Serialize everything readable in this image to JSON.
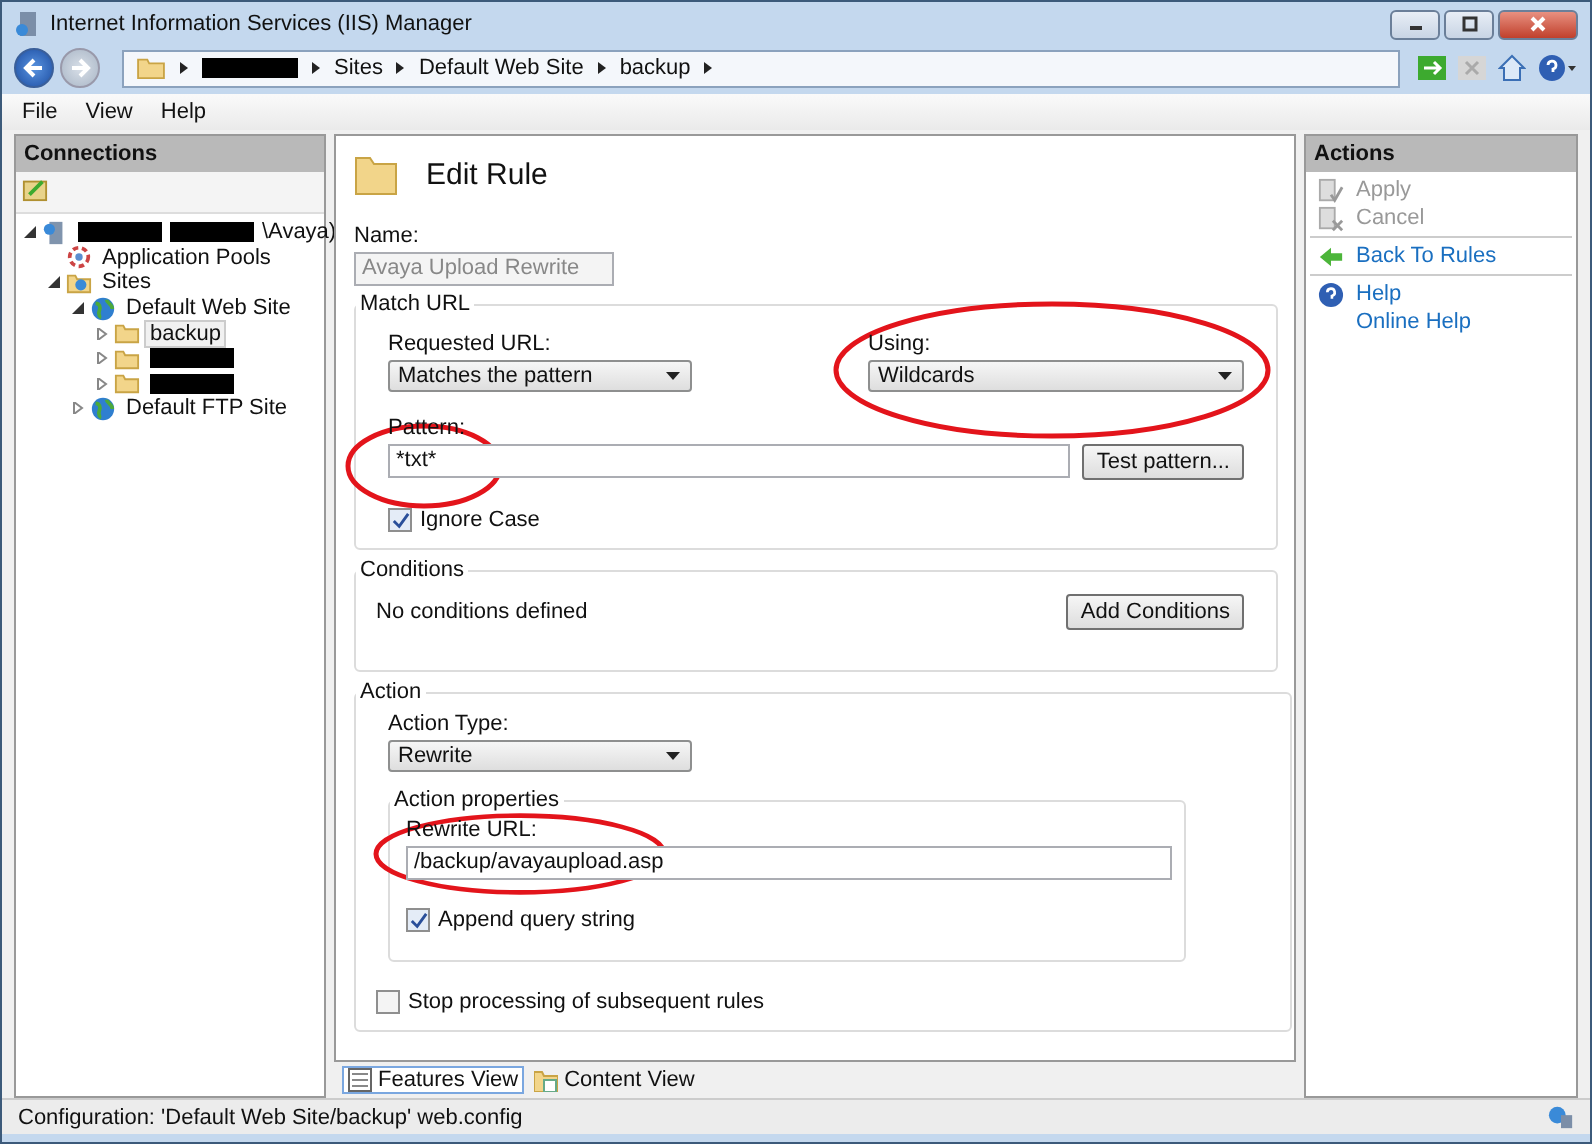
{
  "window": {
    "title": "Internet Information Services (IIS) Manager"
  },
  "address_bar": {
    "crumbs": [
      {
        "kind": "redacted"
      },
      {
        "kind": "text",
        "text": "Sites"
      },
      {
        "kind": "text",
        "text": "Default Web Site"
      },
      {
        "kind": "text",
        "text": "backup"
      }
    ]
  },
  "menu": [
    "File",
    "View",
    "Help"
  ],
  "connections": {
    "title": "Connections",
    "tree": [
      {
        "kind": "server",
        "expanded": true,
        "selected": false,
        "parts": [
          {
            "kind": "redacted"
          },
          {
            "kind": "redacted"
          },
          {
            "kind": "text",
            "text": "\\Avaya)"
          }
        ],
        "children": [
          {
            "kind": "pool",
            "selected": false,
            "parts": [
              {
                "kind": "text",
                "text": "Application Pools"
              }
            ]
          },
          {
            "kind": "sites",
            "expanded": true,
            "selected": false,
            "parts": [
              {
                "kind": "text",
                "text": "Sites"
              }
            ],
            "children": [
              {
                "kind": "globe",
                "expanded": true,
                "selected": false,
                "parts": [
                  {
                    "kind": "text",
                    "text": "Default Web Site"
                  }
                ],
                "children": [
                  {
                    "kind": "folder",
                    "expanded": false,
                    "selected": true,
                    "parts": [
                      {
                        "kind": "text",
                        "text": "backup"
                      }
                    ]
                  },
                  {
                    "kind": "folder",
                    "expanded": false,
                    "selected": false,
                    "parts": [
                      {
                        "kind": "redacted"
                      }
                    ]
                  },
                  {
                    "kind": "folder",
                    "expanded": false,
                    "selected": false,
                    "parts": [
                      {
                        "kind": "redacted"
                      }
                    ]
                  }
                ]
              },
              {
                "kind": "globe",
                "expanded": false,
                "selected": false,
                "parts": [
                  {
                    "kind": "text",
                    "text": "Default FTP Site"
                  }
                ]
              }
            ]
          }
        ]
      }
    ]
  },
  "editor": {
    "title": "Edit Rule",
    "name_label": "Name:",
    "name_value": "Avaya Upload Rewrite",
    "match_url": {
      "legend": "Match URL",
      "requested_label": "Requested URL:",
      "requested_value": "Matches the pattern",
      "using_label": "Using:",
      "using_value": "Wildcards",
      "using_circled": true,
      "pattern_label": "Pattern:",
      "pattern_value": "*txt*",
      "pattern_circled": true,
      "test_button": "Test pattern...",
      "ignore_case": {
        "label": "Ignore Case",
        "checked": true
      }
    },
    "conditions": {
      "legend": "Conditions",
      "text": "No conditions defined",
      "button": "Add Conditions"
    },
    "action": {
      "legend": "Action",
      "type_label": "Action Type:",
      "type_value": "Rewrite",
      "properties": {
        "legend": "Action properties",
        "url_label": "Rewrite URL:",
        "url_value": "/backup/avayaupload.asp",
        "url_circled": true,
        "append": {
          "label": "Append query string",
          "checked": true
        }
      },
      "stop": {
        "label": "Stop processing of subsequent rules",
        "checked": false
      }
    }
  },
  "view_tabs": [
    {
      "label": "Features View",
      "kind": "features",
      "selected": true
    },
    {
      "label": "Content View",
      "kind": "content",
      "selected": false
    }
  ],
  "actions": {
    "title": "Actions",
    "groups": [
      [
        {
          "label": "Apply",
          "kind": "apply",
          "disabled": true
        },
        {
          "label": "Cancel",
          "kind": "cancel",
          "disabled": true
        }
      ],
      [
        {
          "label": "Back To Rules",
          "kind": "back",
          "disabled": false
        }
      ],
      [
        {
          "label": "Help",
          "kind": "help",
          "disabled": false
        },
        {
          "label": "Online Help",
          "kind": "plain",
          "disabled": false
        }
      ]
    ]
  },
  "status_bar": {
    "text": "Configuration: 'Default Web Site/backup' web.config"
  }
}
